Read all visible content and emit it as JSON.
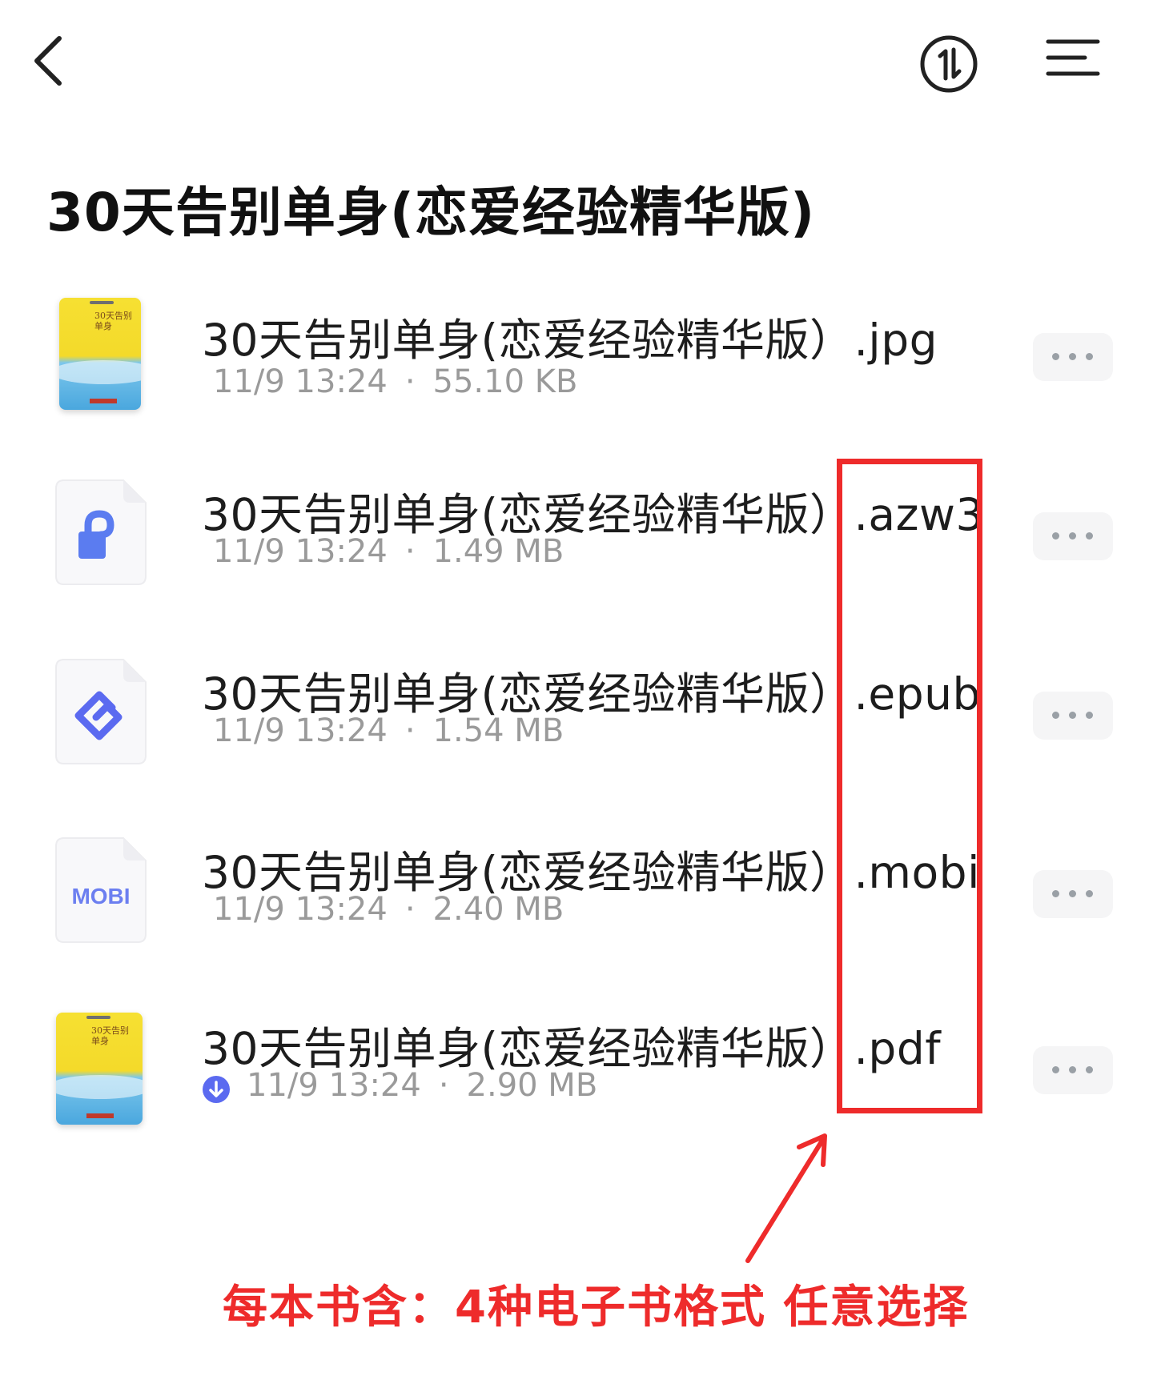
{
  "toolbar": {
    "back_icon": "chevron-left-icon",
    "sort_icon": "sort-icon",
    "menu_icon": "menu-icon"
  },
  "title": "30天告别单身(恋爱经验精华版)",
  "files": [
    {
      "name": "30天告别单身(恋爱经验精华版）.jpg",
      "date": "11/9 13:24",
      "separator": "·",
      "size": "55.10 KB",
      "icon": "book-cover-thumbnail",
      "cover_text": "30天告别单身"
    },
    {
      "name": "30天告别单身(恋爱经验精华版）.azw3",
      "date": "11/9 13:24",
      "separator": "·",
      "size": "1.49 MB",
      "icon": "azw3-file-icon"
    },
    {
      "name": "30天告别单身(恋爱经验精华版）.epub",
      "date": "11/9 13:24",
      "separator": "·",
      "size": "1.54 MB",
      "icon": "epub-file-icon"
    },
    {
      "name": "30天告别单身(恋爱经验精华版）.mobi",
      "date": "11/9 13:24",
      "separator": "·",
      "size": "2.40 MB",
      "icon": "mobi-file-icon",
      "icon_label": "MOBI"
    },
    {
      "name": "30天告别单身(恋爱经验精华版）.pdf",
      "date": "11/9 13:24",
      "separator": "·",
      "size": "2.90 MB",
      "icon": "book-cover-thumbnail",
      "cover_text": "30天告别单身",
      "status_icon": "downloaded-icon"
    }
  ],
  "annotation": {
    "text": "每本书含：4种电子书格式 任意选择",
    "color": "#ee2b2b"
  },
  "colors": {
    "accent": "#5b6af0",
    "annotation": "#ee2b2b",
    "meta_text": "#9a9a9a"
  }
}
